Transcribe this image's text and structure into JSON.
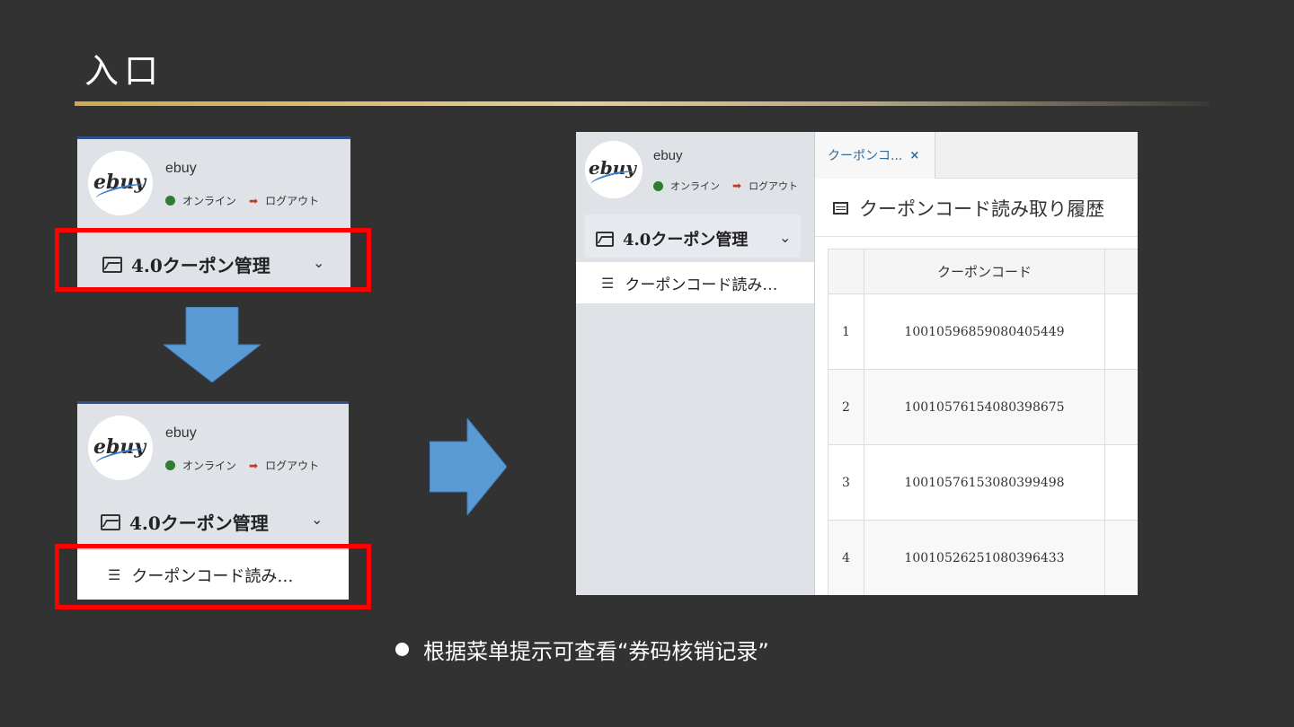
{
  "slide": {
    "title": "入口",
    "caption": "根据菜单提示可查看“券码核销记录”"
  },
  "sidebar": {
    "logo_text": "ebuy",
    "user_name": "ebuy",
    "status_online": "オンライン",
    "logout": "ログアウト",
    "menu_coupon": "4.0クーポン管理",
    "submenu_history": "クーポンコード読み…"
  },
  "main": {
    "tab_label": "クーポンコ...",
    "tab_close": "×",
    "page_title": "クーポンコード読み取り履歴",
    "table": {
      "header_code": "クーポンコード",
      "rows": [
        {
          "no": "1",
          "code": "10010596859080405449"
        },
        {
          "no": "2",
          "code": "10010576154080398675"
        },
        {
          "no": "3",
          "code": "10010576153080399498"
        },
        {
          "no": "4",
          "code": "10010526251080396433"
        }
      ]
    }
  },
  "colors": {
    "highlight_red": "#ff0000",
    "arrow_blue": "#5b9bd5",
    "title_gold": "#cfa94f"
  },
  "icons": {
    "menu_icon": "image-icon",
    "submenu_icon": "list-icon",
    "page_icon": "document-icon",
    "chevron": "chevron-down-icon"
  }
}
